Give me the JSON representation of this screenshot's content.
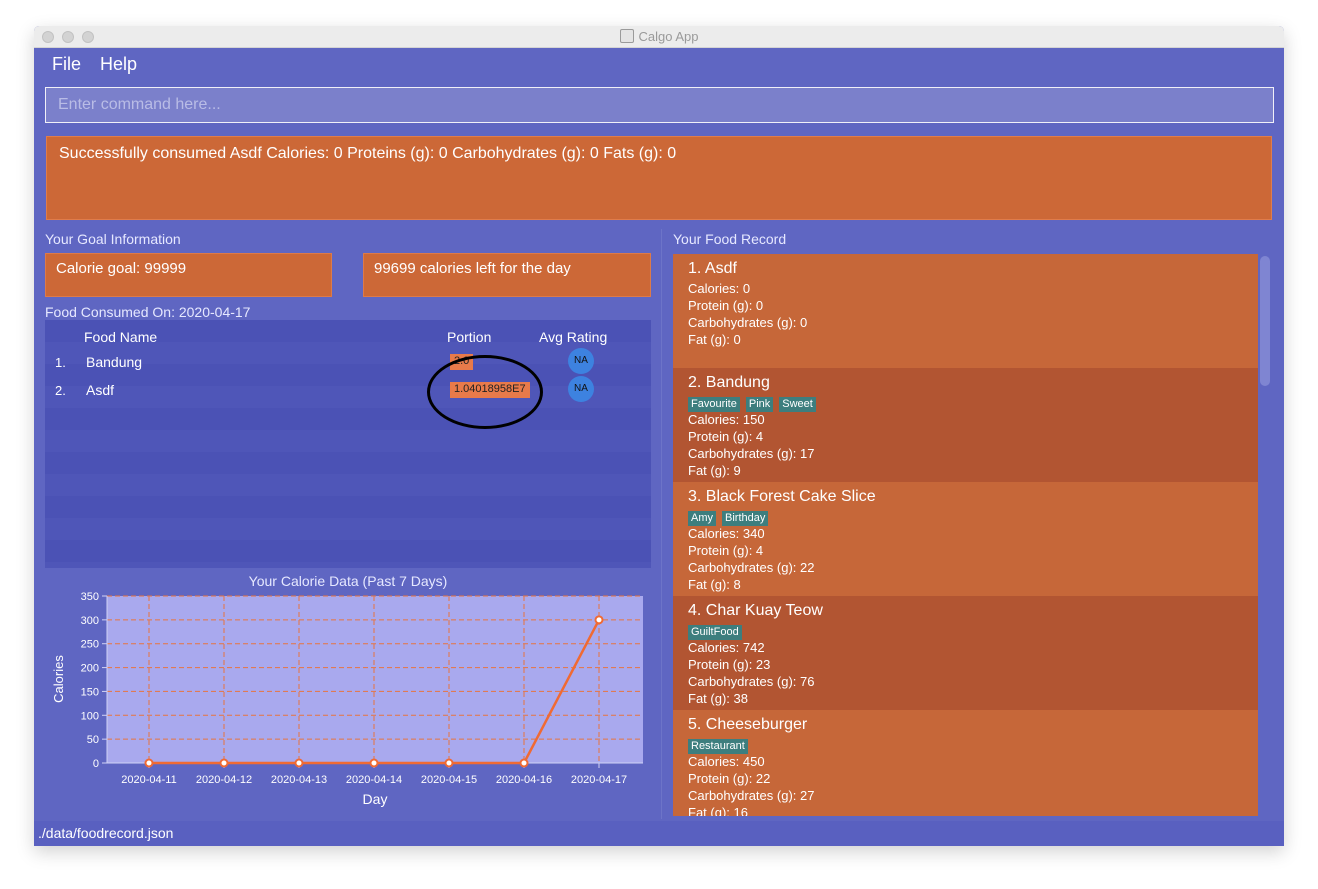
{
  "window": {
    "title": "Calgo App"
  },
  "menu": {
    "file": "File",
    "help": "Help"
  },
  "command": {
    "placeholder": "Enter command here...",
    "value": ""
  },
  "result": {
    "message": "Successfully consumed Asdf Calories: 0 Proteins (g): 0 Carbohydrates (g): 0 Fats (g): 0"
  },
  "goal": {
    "section_label": "Your Goal Information",
    "calorie_goal": "Calorie goal: 99999",
    "calories_left": "99699 calories left for the day"
  },
  "consumed": {
    "section_label": "Food Consumed On: 2020-04-17",
    "headers": {
      "name": "Food Name",
      "portion": "Portion",
      "rating": "Avg Rating"
    },
    "rows": [
      {
        "index": "1.",
        "name": "Bandung",
        "portion": "2.0",
        "rating": "NA"
      },
      {
        "index": "2.",
        "name": "Asdf",
        "portion": "1.04018958E7",
        "rating": "NA"
      }
    ]
  },
  "record": {
    "section_label": "Your Food Record",
    "items": [
      {
        "title": "1.  Asdf",
        "tags": [],
        "calories": "Calories: 0",
        "protein": "Protein (g): 0",
        "carbs": "Carbohydrates (g): 0",
        "fat": "Fat (g): 0"
      },
      {
        "title": "2.  Bandung",
        "tags": [
          "Favourite",
          "Pink",
          "Sweet"
        ],
        "calories": "Calories: 150",
        "protein": "Protein (g): 4",
        "carbs": "Carbohydrates (g): 17",
        "fat": "Fat (g): 9"
      },
      {
        "title": "3.  Black Forest Cake Slice",
        "tags": [
          "Amy",
          "Birthday"
        ],
        "calories": "Calories: 340",
        "protein": "Protein (g): 4",
        "carbs": "Carbohydrates (g): 22",
        "fat": "Fat (g): 8"
      },
      {
        "title": "4.  Char Kuay Teow",
        "tags": [
          "GuiltFood"
        ],
        "calories": "Calories: 742",
        "protein": "Protein (g): 23",
        "carbs": "Carbohydrates (g): 76",
        "fat": "Fat (g): 38"
      },
      {
        "title": "5.  Cheeseburger",
        "tags": [
          "Restaurant"
        ],
        "calories": "Calories: 450",
        "protein": "Protein (g): 22",
        "carbs": "Carbohydrates (g): 27",
        "fat": "Fat (g): 16"
      }
    ]
  },
  "status": {
    "path": "./data/foodrecord.json"
  },
  "colors": {
    "background": "#5f66c2",
    "accent": "#cc6837",
    "plot_bg": "#a9a9ee",
    "line": "#f06a33"
  },
  "chart_data": {
    "type": "line",
    "title": "Your Calorie Data (Past 7 Days)",
    "xlabel": "Day",
    "ylabel": "Calories",
    "categories": [
      "2020-04-11",
      "2020-04-12",
      "2020-04-13",
      "2020-04-14",
      "2020-04-15",
      "2020-04-16",
      "2020-04-17"
    ],
    "series": [
      {
        "values": [
          0,
          0,
          0,
          0,
          0,
          0,
          300
        ]
      }
    ],
    "ylim": [
      0,
      350
    ],
    "yticks": [
      0,
      50,
      100,
      150,
      200,
      250,
      300,
      350
    ],
    "grid": true,
    "legend": "none"
  }
}
